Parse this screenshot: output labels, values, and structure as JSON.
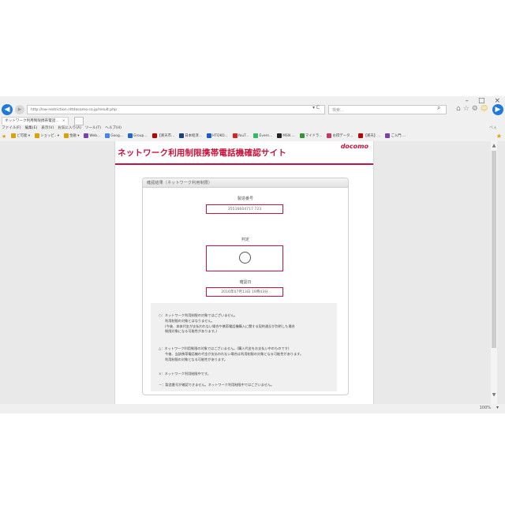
{
  "window": {
    "minimize": "–",
    "maximize": "□",
    "close": "×"
  },
  "toolbar": {
    "back_icon": "arrow-left",
    "forward_icon": "arrow-right",
    "address": "http://nw-restriction.nttdocomo.co.jp/result.php",
    "address_controls": "▾ C",
    "search_placeholder": "検索...",
    "search_icon": "magnifier",
    "tool_icons": [
      "home-icon",
      "star-icon",
      "gear-icon",
      "smiley-icon"
    ]
  },
  "tabs": [
    {
      "label": "ネットワーク利用制限携帯電話...",
      "close": "×"
    }
  ],
  "menu": {
    "items": [
      "ファイル(F)",
      "編集(E)",
      "表示(V)",
      "お気に入り(A)",
      "ツール(T)",
      "ヘルプ(H)"
    ],
    "right": "ぺぇ"
  },
  "favorites": {
    "items": [
      {
        "label": "ど可能 ▾",
        "color": "#e0a000"
      },
      {
        "label": "ショッピ.. ▾",
        "color": "#e0a000"
      },
      {
        "label": "金融 ▾",
        "color": "#e0a000"
      },
      {
        "label": "Web...",
        "color": "#7a3fb0"
      },
      {
        "label": "Goog...",
        "color": "#4285f4"
      },
      {
        "label": "Group...",
        "color": "#2266cc"
      },
      {
        "label": "【楽天市...",
        "color": "#bf0000"
      },
      {
        "label": "日本経済...",
        "color": "#1a3c8c"
      },
      {
        "label": "HTOKO...",
        "color": "#1a5ccc"
      },
      {
        "label": "YouT...",
        "color": "#e02020"
      },
      {
        "label": "Evern...",
        "color": "#2dbe60"
      },
      {
        "label": "MSN ...",
        "color": "#222222"
      },
      {
        "label": "マイドラ...",
        "color": "#3a8f3a"
      },
      {
        "label": "お得データ...",
        "color": "#cc3366"
      },
      {
        "label": "【楽天】...",
        "color": "#bf0000"
      },
      {
        "label": "ご入門 ...",
        "color": "#7a3fb0"
      }
    ]
  },
  "site": {
    "title": "ネットワーク利用制限携帯電話機確認サイト",
    "logo": "docomo",
    "brand_color": "#c8143c"
  },
  "result": {
    "panel_title": "確認結果（ネットワーク利用制限）",
    "serial_label": "製造番号",
    "serial_value": "35516604717 723",
    "judgement_label": "判定",
    "judgement_value": "○",
    "date_label": "確認日",
    "date_value": "2016年07月13日 19時43分"
  },
  "legend": {
    "circle": {
      "head": "○：ネットワーク利用制限の対象ではございません。",
      "lines": [
        "利用制限の対象とはなりません。",
        "(今後、本体代金が支払われない場合や携帯電話機購入に関する契約違反が判明した場合",
        "制限対象になる可能性があります。)"
      ]
    },
    "triangle": {
      "head": "△：ネットワーク利用制限の対象ではございません。(購入代金をお支払い中のものです)",
      "lines": [
        "今後、当該携帯電話機の代金が支払われない場合は利用制限の対象となる可能性があります。",
        "利用制限の対象となる可能性があります。"
      ]
    },
    "cross": "×：ネットワーク利用制限中です。",
    "dash": "－：製造番号が確認できません。ネットワーク利用制限中ではございません。"
  },
  "status": {
    "zoom": "100%",
    "zoom_dropdown": "▾"
  }
}
